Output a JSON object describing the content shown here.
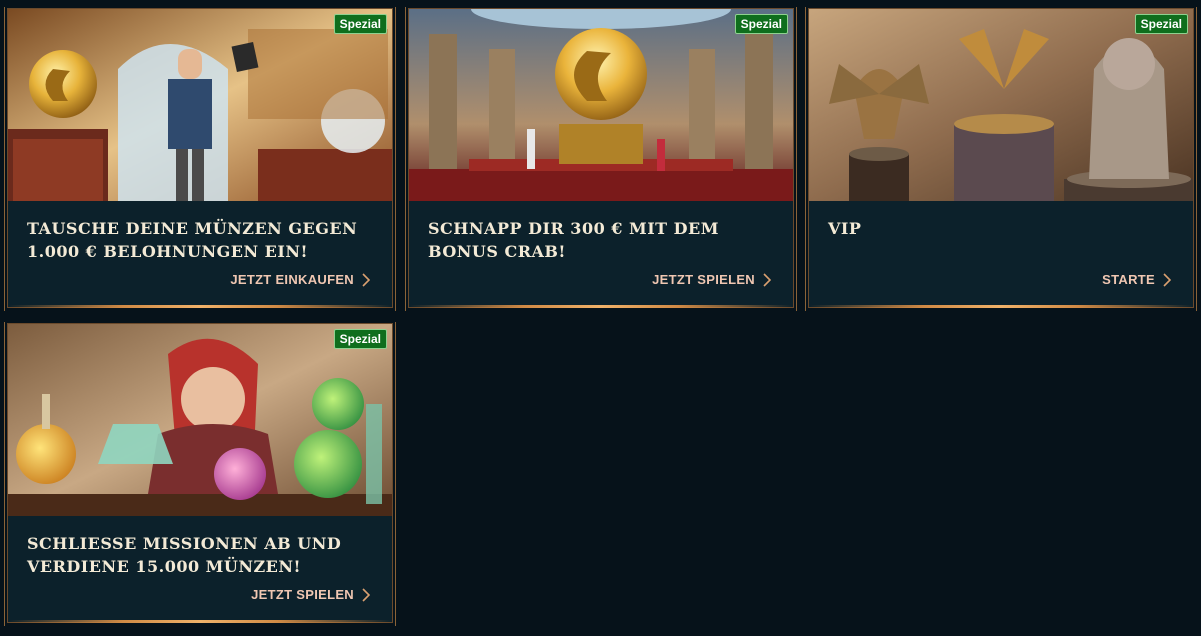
{
  "cards": [
    {
      "badge": "Spezial",
      "title": "TAUSCHE DEINE MÜNZEN GEGEN 1.000 € BELOHNUNGEN EIN!",
      "cta": "JETZT EINKAUFEN",
      "image": "shop-keeper-coin-illustration"
    },
    {
      "badge": "Spezial",
      "title": "SCHNAPP DIR 300 € MIT DEM BONUS CRAB!",
      "cta": "JETZT SPIELEN",
      "image": "temple-golden-coin-illustration"
    },
    {
      "badge": "Spezial",
      "title": "VIP",
      "cta": "STARTE",
      "image": "mechanical-animals-illustration"
    },
    {
      "badge": "Spezial",
      "title": "SCHLIESSE MISSIONEN AB UND VERDIENE 15.000 MÜNZEN!",
      "cta": "JETZT SPIELEN",
      "image": "alchemist-potions-illustration"
    }
  ],
  "colors": {
    "page_background": "#06121a",
    "card_background": "#0c212b",
    "badge_green": "#0f6e1d",
    "title_text": "#f3ead6",
    "cta_text": "#f0c7b2",
    "frame_copper": "#d08a45"
  },
  "icons": {
    "cta": "chevron-right-icon"
  }
}
